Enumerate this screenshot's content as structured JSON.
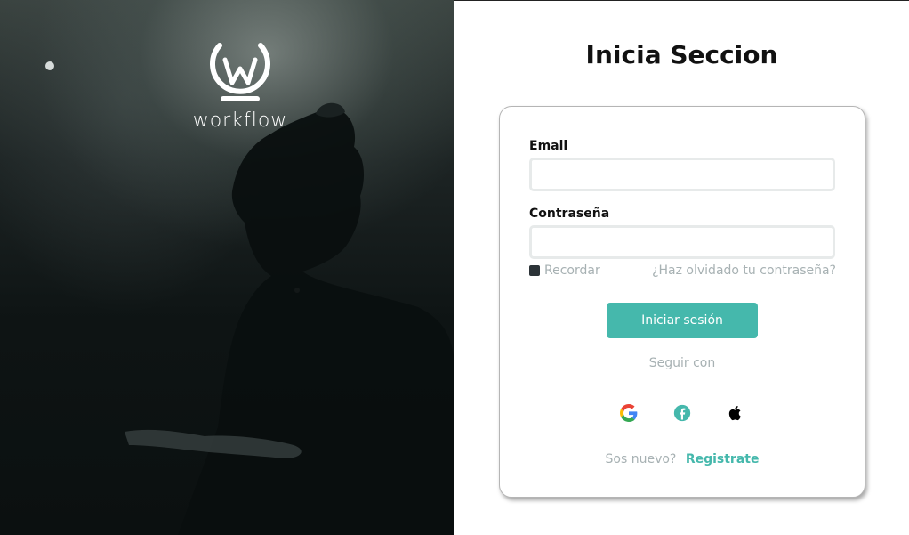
{
  "brand": {
    "name": "workflow",
    "logo_icon": "workflow-logo-icon"
  },
  "login": {
    "title": "Inicia Seccion",
    "email_label": "Email",
    "email_value": "",
    "password_label": "Contraseña",
    "password_value": "",
    "remember_label": "Recordar",
    "remember_checked": true,
    "forgot_link": "¿Haz olvidado tu contraseña?",
    "submit_label": "Iniciar sesión",
    "follow_text": "Seguir con",
    "social": [
      {
        "name": "google",
        "icon": "google-icon"
      },
      {
        "name": "facebook",
        "icon": "facebook-icon"
      },
      {
        "name": "apple",
        "icon": "apple-icon"
      }
    ],
    "new_user_text": "Sos nuevo?",
    "signup_link": "Registrate"
  },
  "colors": {
    "accent": "#45b8ac",
    "muted": "#a7b1b3",
    "title": "#111111"
  }
}
